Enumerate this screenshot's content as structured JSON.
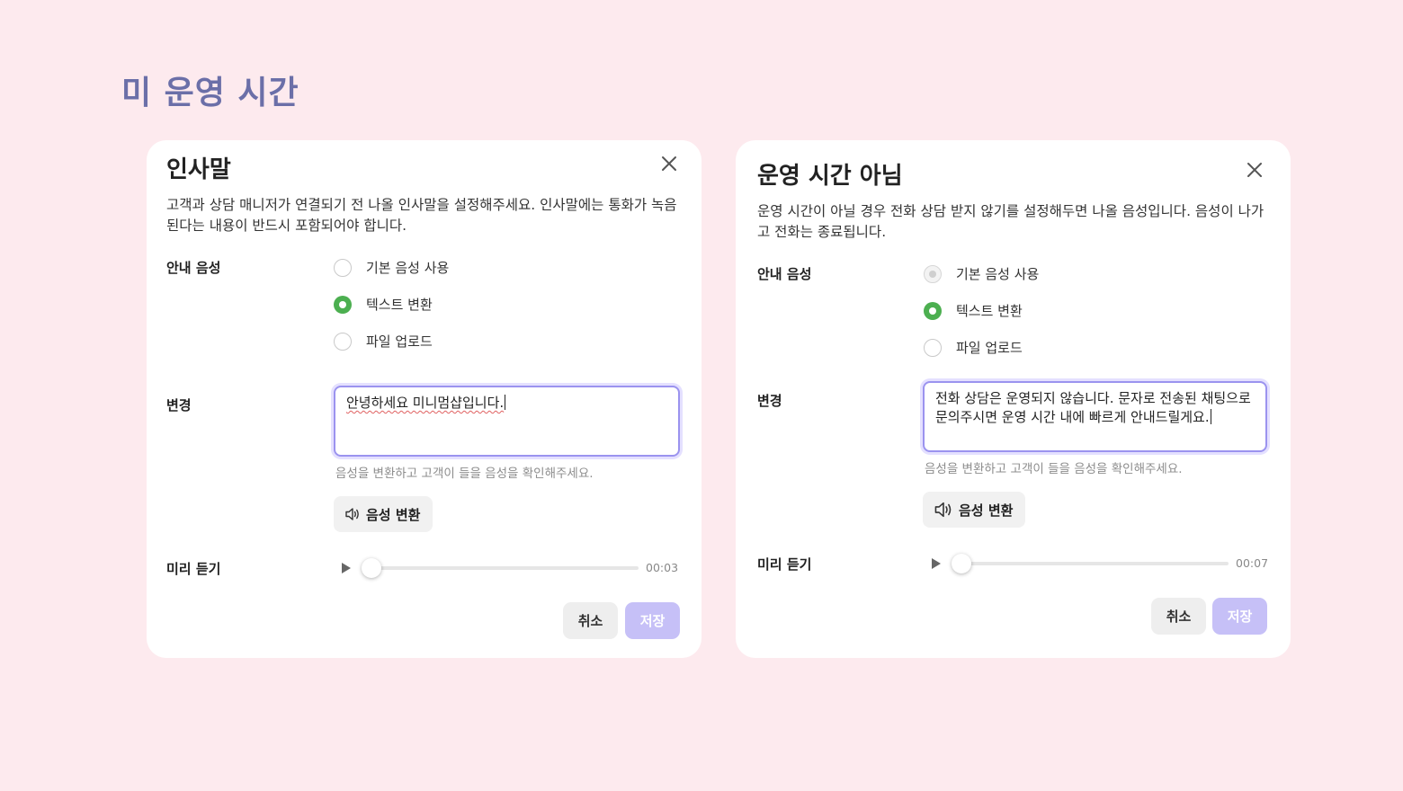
{
  "page": {
    "title": "미 운영 시간"
  },
  "cards": [
    {
      "title": "인사말",
      "description": "고객과 상담 매니저가 연결되기 전 나올 인사말을 설정해주세요. 인사말에는 통화가 녹음된다는 내용이 반드시 포함되어야 합니다.",
      "voice_label": "안내 음성",
      "options": [
        {
          "label": "기본 음성 사용",
          "state": "unchecked"
        },
        {
          "label": "텍스트 변환",
          "state": "checked"
        },
        {
          "label": "파일 업로드",
          "state": "unchecked"
        }
      ],
      "change_label": "변경",
      "text_value": "안녕하세요 미니멈샵입니다.",
      "hint": "음성을 변환하고 고객이 들을 음성을 확인해주세요.",
      "tts_button": "음성 변환",
      "preview_label": "미리 듣기",
      "duration": "00:03",
      "progress": 0,
      "cancel": "취소",
      "save": "저장"
    },
    {
      "title": "운영 시간 아님",
      "description": "운영 시간이 아닐 경우 전화 상담 받지 않기를 설정해두면 나올 음성입니다. 음성이 나가고 전화는 종료됩니다.",
      "voice_label": "안내 음성",
      "options": [
        {
          "label": "기본 음성 사용",
          "state": "disabled"
        },
        {
          "label": "텍스트 변환",
          "state": "checked"
        },
        {
          "label": "파일 업로드",
          "state": "unchecked"
        }
      ],
      "change_label": "변경",
      "text_value": "전화 상담은 운영되지 않습니다. 문자로 전송된 채팅으로 문의주시면 운영 시간 내에 빠르게 안내드릴게요.",
      "hint": "음성을 변환하고 고객이 들을 음성을 확인해주세요.",
      "tts_button": "음성 변환",
      "preview_label": "미리 듣기",
      "duration": "00:07",
      "progress": 0,
      "cancel": "취소",
      "save": "저장"
    }
  ],
  "colors": {
    "background": "#fdeaee",
    "title": "#6b6fa8",
    "radio_checked": "#4caf50",
    "focus_border": "#9b93ef",
    "save_disabled": "#c6c0f7"
  },
  "icons": [
    "close-icon",
    "speaker-icon",
    "play-icon"
  ]
}
